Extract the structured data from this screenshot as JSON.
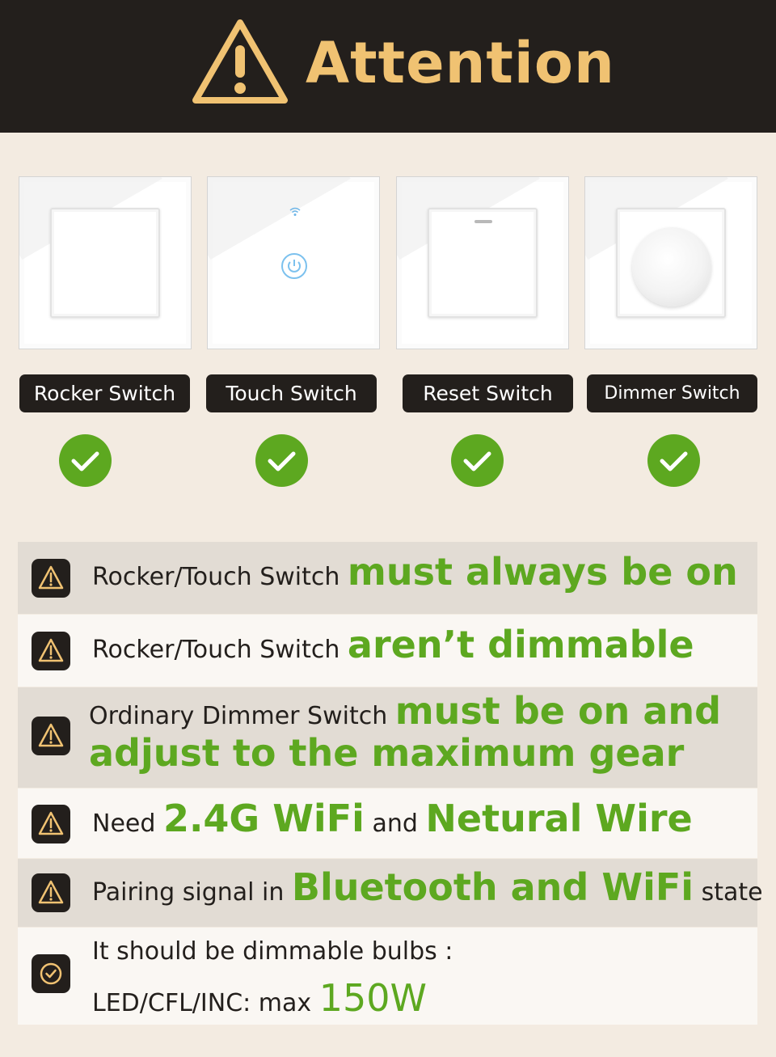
{
  "header": {
    "title": "Attention",
    "title_color": "#f0c272",
    "icon": "warning-triangle-icon"
  },
  "switches": [
    {
      "label": "Rocker Switch",
      "icon": "check-icon"
    },
    {
      "label": "Touch Switch",
      "icon": "check-icon"
    },
    {
      "label": "Reset Switch",
      "icon": "check-icon"
    },
    {
      "label": "Dimmer Switch",
      "icon": "check-icon"
    }
  ],
  "notes": [
    {
      "icon": "warning-icon",
      "parts": [
        "Rocker/Touch Switch ",
        "must always be on"
      ]
    },
    {
      "icon": "warning-icon",
      "parts": [
        "Rocker/Touch Switch ",
        "aren’t dimmable"
      ]
    },
    {
      "icon": "warning-icon",
      "parts": [
        "Ordinary Dimmer Switch ",
        "must  be on and",
        "adjust to the maximum gear"
      ]
    },
    {
      "icon": "warning-icon",
      "parts": [
        "Need ",
        "2.4G WiFi",
        " and ",
        "Netural Wire"
      ]
    },
    {
      "icon": "warning-icon",
      "parts": [
        "Pairing signal in ",
        "Bluetooth and WiFi",
        " state"
      ]
    },
    {
      "icon": "check-circle-icon",
      "parts": [
        "It should be dimmable bulbs :",
        "LED/CFL/INC: max ",
        "150W"
      ]
    }
  ],
  "colors": {
    "accent_green": "#5da820",
    "dark": "#231f1c",
    "gold": "#f0c272",
    "background": "#f3ebe1"
  }
}
